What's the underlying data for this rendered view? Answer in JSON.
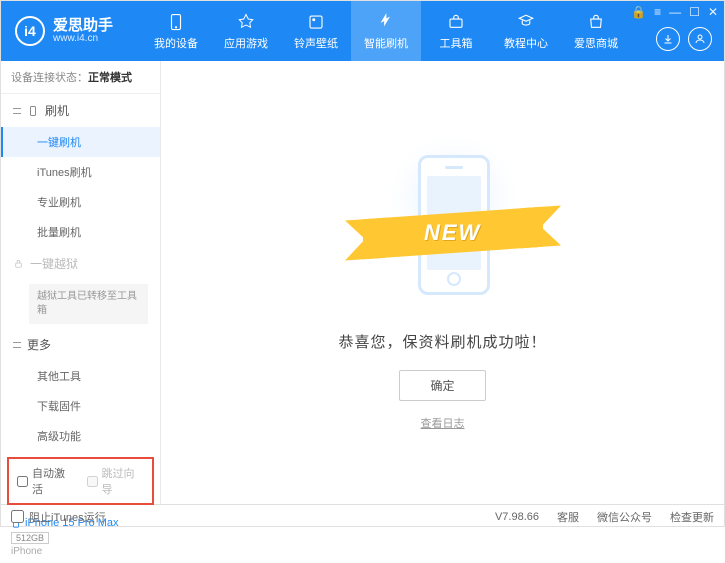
{
  "app": {
    "name": "爱思助手",
    "url": "www.i4.cn"
  },
  "nav": [
    {
      "label": "我的设备"
    },
    {
      "label": "应用游戏"
    },
    {
      "label": "铃声壁纸"
    },
    {
      "label": "智能刷机"
    },
    {
      "label": "工具箱"
    },
    {
      "label": "教程中心"
    },
    {
      "label": "爱思商城"
    }
  ],
  "status": {
    "prefix": "设备连接状态：",
    "mode": "正常模式"
  },
  "sidebar": {
    "flash": {
      "title": "刷机",
      "items": [
        "一键刷机",
        "iTunes刷机",
        "专业刷机",
        "批量刷机"
      ]
    },
    "jailbreak": {
      "title": "一键越狱",
      "note": "越狱工具已转移至工具箱"
    },
    "more": {
      "title": "更多",
      "items": [
        "其他工具",
        "下载固件",
        "高级功能"
      ]
    },
    "checks": {
      "auto": "自动激活",
      "skip": "跳过向导"
    }
  },
  "device": {
    "name": "iPhone 15 Pro Max",
    "storage": "512GB",
    "type": "iPhone"
  },
  "main": {
    "ribbon": "NEW",
    "success": "恭喜您，保资料刷机成功啦！",
    "ok": "确定",
    "log": "查看日志"
  },
  "footer": {
    "block": "阻止iTunes运行",
    "version": "V7.98.66",
    "service": "客服",
    "wechat": "微信公众号",
    "update": "检查更新"
  }
}
